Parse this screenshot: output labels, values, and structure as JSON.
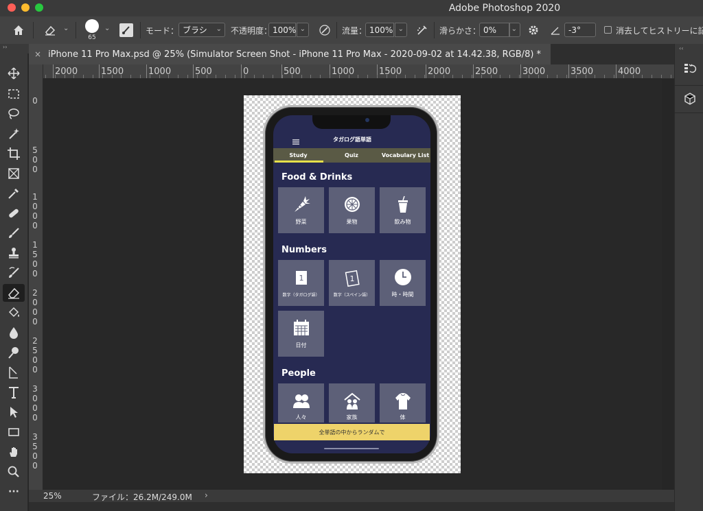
{
  "window": {
    "title": "Adobe Photoshop 2020",
    "traffic_lights": {
      "close": "#fe5f57",
      "minimize": "#febc2e",
      "zoom": "#28c840"
    }
  },
  "options_bar": {
    "brush_size": "65",
    "mode_label": "モード：",
    "mode_value": "ブラシ",
    "opacity_label": "不透明度：",
    "opacity_value": "100%",
    "flow_label": "流量：",
    "flow_value": "100%",
    "smoothing_label": "滑らかさ：",
    "smoothing_value": "0%",
    "angle_value": "-3°",
    "erase_history_label": "消去してヒストリーに記録"
  },
  "document": {
    "tab_title": "iPhone 11 Pro Max.psd @ 25% (Simulator Screen Shot - iPhone 11 Pro Max - 2020-09-02 at 14.42.38, RGB/8) *"
  },
  "rulers": {
    "horizontal": [
      "2000",
      "1500",
      "1000",
      "500",
      "0",
      "500",
      "1000",
      "1500",
      "2000",
      "2500",
      "3000",
      "3500",
      "4000"
    ],
    "vertical": [
      "0",
      "5\n0\n0",
      "1\n0\n0\n0",
      "1\n5\n0\n0",
      "2\n0\n0\n0",
      "2\n5\n0\n0",
      "3\n0\n0\n0",
      "3\n5\n0\n0"
    ]
  },
  "app": {
    "header_title": "タガログ語単語",
    "tabs": [
      "Study",
      "Quiz",
      "Vocabulary List"
    ],
    "active_tab_color": "#e6e04a",
    "sections": [
      {
        "title": "Food & Drinks",
        "items": [
          {
            "label": "野菜",
            "icon": "carrot-icon"
          },
          {
            "label": "果物",
            "icon": "citrus-icon"
          },
          {
            "label": "飲み物",
            "icon": "drink-cup-icon"
          }
        ]
      },
      {
        "title": "Numbers",
        "items": [
          {
            "label": "数字（タガログ語）",
            "icon": "number-card-icon"
          },
          {
            "label": "数字（スペイン語）",
            "icon": "tilted-number-card-icon"
          },
          {
            "label": "時・時間",
            "icon": "clock-icon"
          },
          {
            "label": "日付",
            "icon": "calendar-icon"
          }
        ]
      },
      {
        "title": "People",
        "items": [
          {
            "label": "人々",
            "icon": "people-icon"
          },
          {
            "label": "家族",
            "icon": "family-house-icon"
          },
          {
            "label": "体",
            "icon": "body-icon"
          }
        ]
      }
    ],
    "random_button": "全単語の中からランダムで"
  },
  "status_bar": {
    "zoom": "25%",
    "file_info": "ファイル：26.2M/249.0M"
  }
}
